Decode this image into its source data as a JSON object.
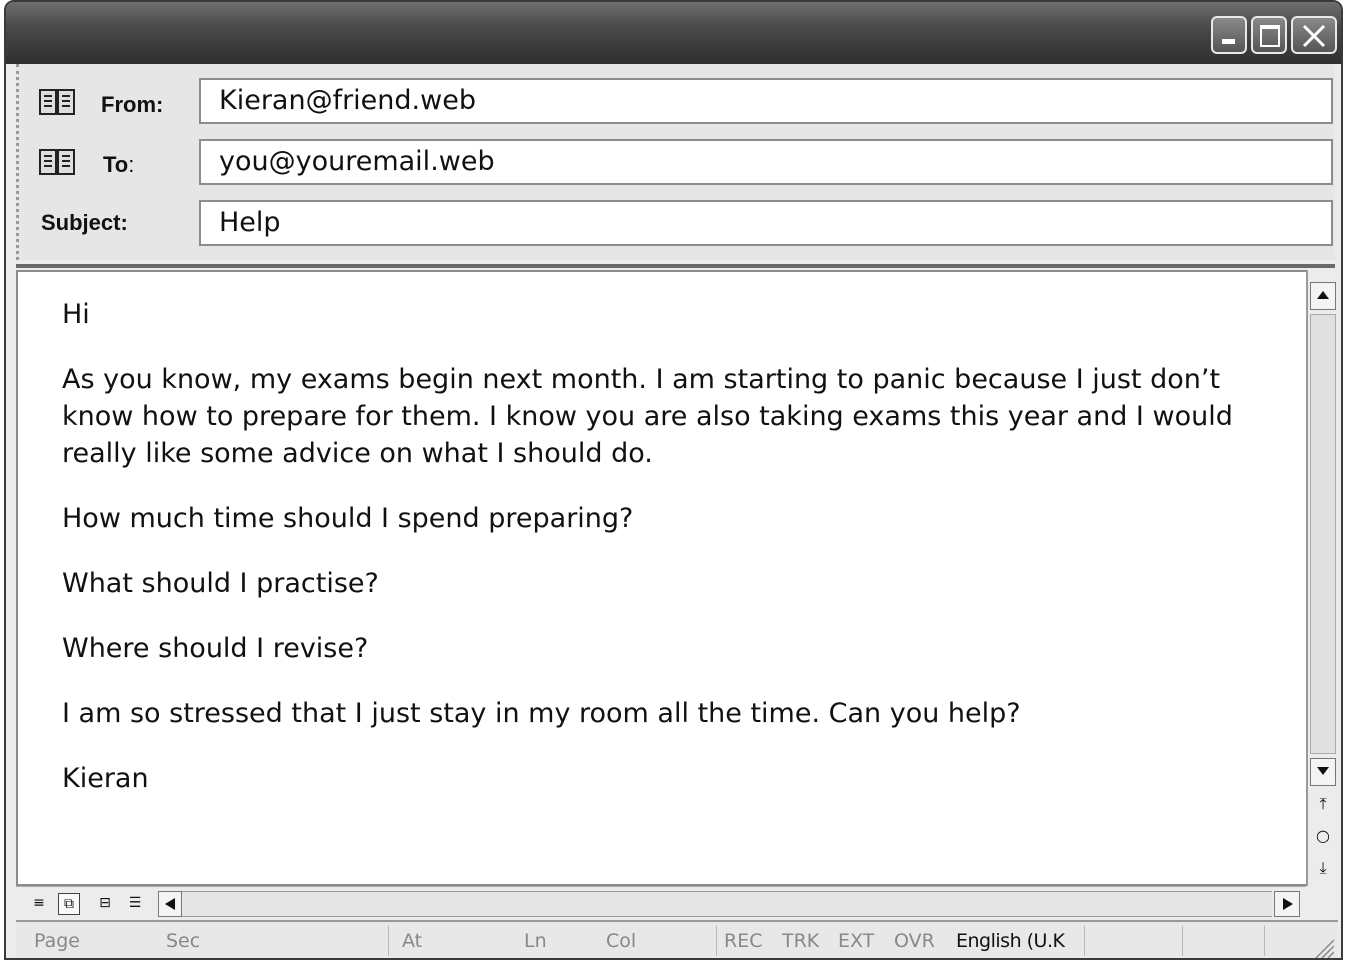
{
  "window": {
    "controls": [
      "minimize-icon",
      "maximize-icon",
      "close-icon"
    ]
  },
  "header": {
    "from_label": "From:",
    "from_value": "Kieran@friend.web",
    "to_label": "To",
    "to_colon": ":",
    "to_value": "you@youremail.web",
    "subject_label": "Subject:",
    "subject_value": "Help"
  },
  "message": {
    "paragraphs": [
      "Hi",
      "As you know, my exams begin next month. I am starting to panic because I just don’t know how to prepare for them. I know you are also taking exams this year and I would really like some advice on what I should do.",
      "How much time should I spend preparing?",
      "What should I practise?",
      "Where should I revise?",
      "I am so stressed that I just stay in my room all the time. Can you help?",
      "Kieran"
    ]
  },
  "scrollbar": {
    "nav_prev": "⤒",
    "nav_select": "○",
    "nav_next": "⤓"
  },
  "statusbar": {
    "page": "Page",
    "sec": "Sec",
    "at": "At",
    "ln": "Ln",
    "col": "Col",
    "rec": "REC",
    "trk": "TRK",
    "ext": "EXT",
    "ovr": "OVR",
    "language": "English (U.K"
  }
}
